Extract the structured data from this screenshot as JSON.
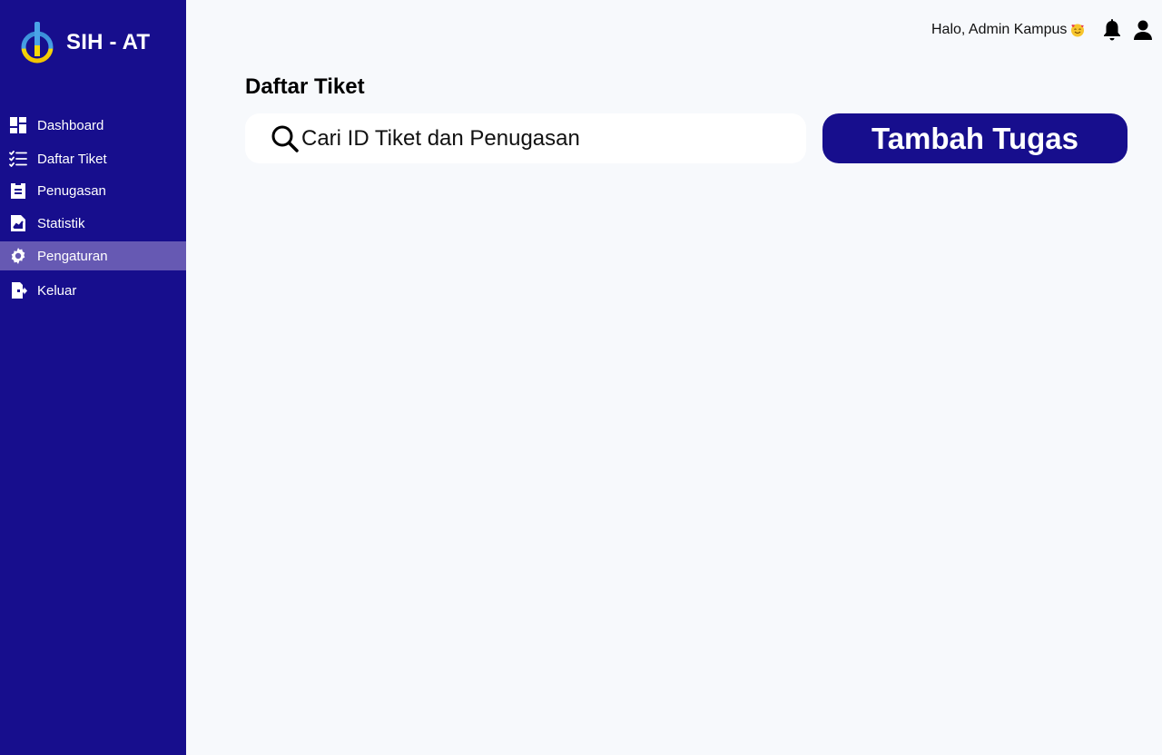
{
  "brand": {
    "name": "SIH - AT",
    "logo_icon": "sih-at-logo-icon"
  },
  "sidebar": {
    "items": [
      {
        "label": "Dashboard",
        "icon": "dashboard-icon",
        "active": false
      },
      {
        "label": "Daftar Tiket",
        "icon": "checklist-icon",
        "active": false
      },
      {
        "label": "Penugasan",
        "icon": "assignment-icon",
        "active": false
      },
      {
        "label": "Statistik",
        "icon": "chart-file-icon",
        "active": true
      },
      {
        "label": "Pengaturan",
        "icon": "gear-icon",
        "active": true
      },
      {
        "label": "Keluar",
        "icon": "logout-icon",
        "active": false
      }
    ]
  },
  "header": {
    "greeting": "Halo, Admin Kampus",
    "emoji_icon": "smiling-face-with-hearts-icon",
    "notification_icon": "bell-icon",
    "profile_icon": "user-icon"
  },
  "main": {
    "title": "Daftar Tiket",
    "search": {
      "placeholder": "Cari ID Tiket dan Penugasan",
      "value": ""
    },
    "add_button_label": "Tambah Tugas"
  },
  "colors": {
    "primary": "#170e8d",
    "active_nav": "#6659b3",
    "background": "#f7f9fc",
    "surface": "#ffffff"
  }
}
